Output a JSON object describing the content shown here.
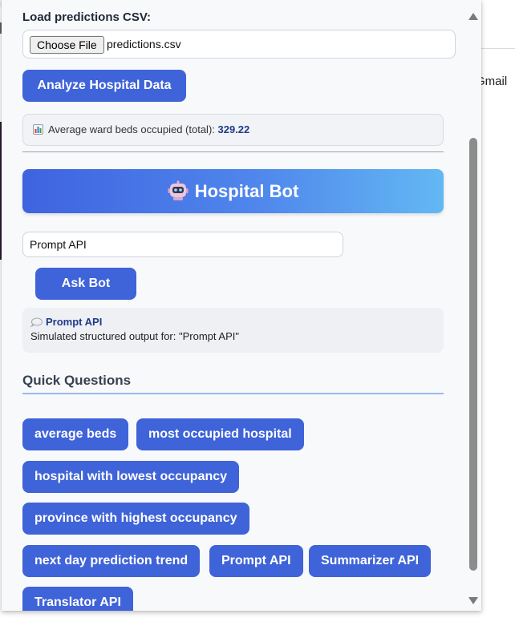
{
  "background": {
    "side_text": "Gmail"
  },
  "upload": {
    "label": "Load predictions CSV:",
    "choose_button": "Choose File",
    "file_name": "predictions.csv"
  },
  "analyze_button": "Analyze Hospital Data",
  "stats": {
    "icon": "bar-chart-icon",
    "label": "Average ward beds occupied (total): ",
    "value": "329.22"
  },
  "bot": {
    "icon": "robot-icon",
    "title": "Hospital Bot",
    "input_value": "Prompt API",
    "ask_button": "Ask Bot",
    "response": {
      "icon": "speech-bubble-icon",
      "title": "Prompt API",
      "text": "Simulated structured output for: \"Prompt API\""
    }
  },
  "quick_questions": {
    "title": "Quick Questions",
    "items": [
      "average beds",
      "most occupied hospital",
      "hospital with lowest occupancy",
      "province with highest occupancy",
      "next day prediction trend",
      "Prompt API",
      "Summarizer API",
      "Translator API"
    ]
  },
  "colors": {
    "primary": "#3f63d8",
    "header_gradient_start": "#3f63e0",
    "header_gradient_end": "#63b8f3",
    "accent_text": "#1e3a8a"
  }
}
